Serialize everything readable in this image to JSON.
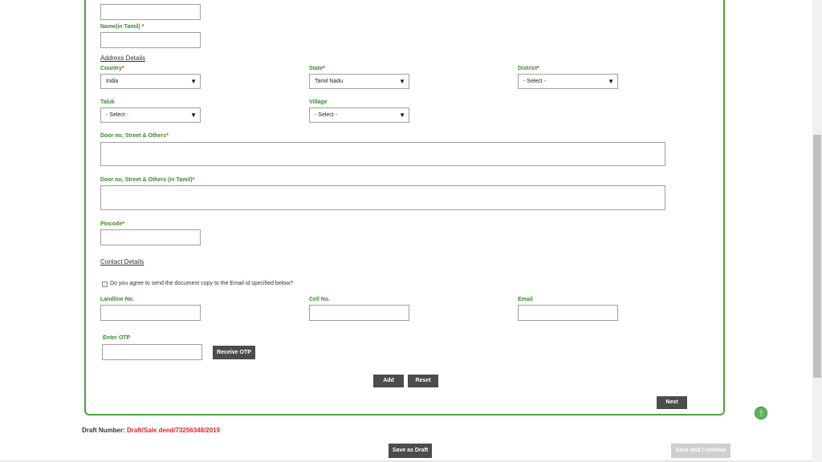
{
  "form": {
    "name_tamil_label": "Name(in Tamil)",
    "required_marker": "*",
    "address_section": "Address Details",
    "country": {
      "label": "Country",
      "value": "India"
    },
    "state": {
      "label": "State",
      "value": "Tamil Nadu"
    },
    "district": {
      "label": "District",
      "value": "- Select -"
    },
    "taluk": {
      "label": "Taluk",
      "value": "- Select -"
    },
    "village": {
      "label": "Village",
      "value": "- Select -"
    },
    "door_label": "Door no, Street & Others",
    "door_tamil_label": "Door no, Street & Others (in Tamil)",
    "pincode_label": "Pincode",
    "contact_section": "Contact Details",
    "email_consent": "Do you agree to send the document copy to the Email id specified below?",
    "landline_label": "Landline No.",
    "cell_label": "Cell No.",
    "email_label": "Email",
    "otp_label": "Enter OTP",
    "receive_otp": "Receive OTP",
    "add": "Add",
    "reset": "Reset",
    "next": "Next"
  },
  "footer": {
    "draft_number_label": "Draft Number:",
    "draft_number_value": "Draft/Sale deed/73256348/2019",
    "save_as_draft": "Save as Draft",
    "save_and_continue": "Save and Continue"
  },
  "icons": {
    "scroll_top": "arrow-up-circle-icon",
    "dropdown": "triangle-down-icon"
  },
  "colors": {
    "accent_green": "#4aa33f",
    "label_green": "#3a8a2f",
    "required_red": "#e02424",
    "button_dark": "#4c4c4c"
  }
}
